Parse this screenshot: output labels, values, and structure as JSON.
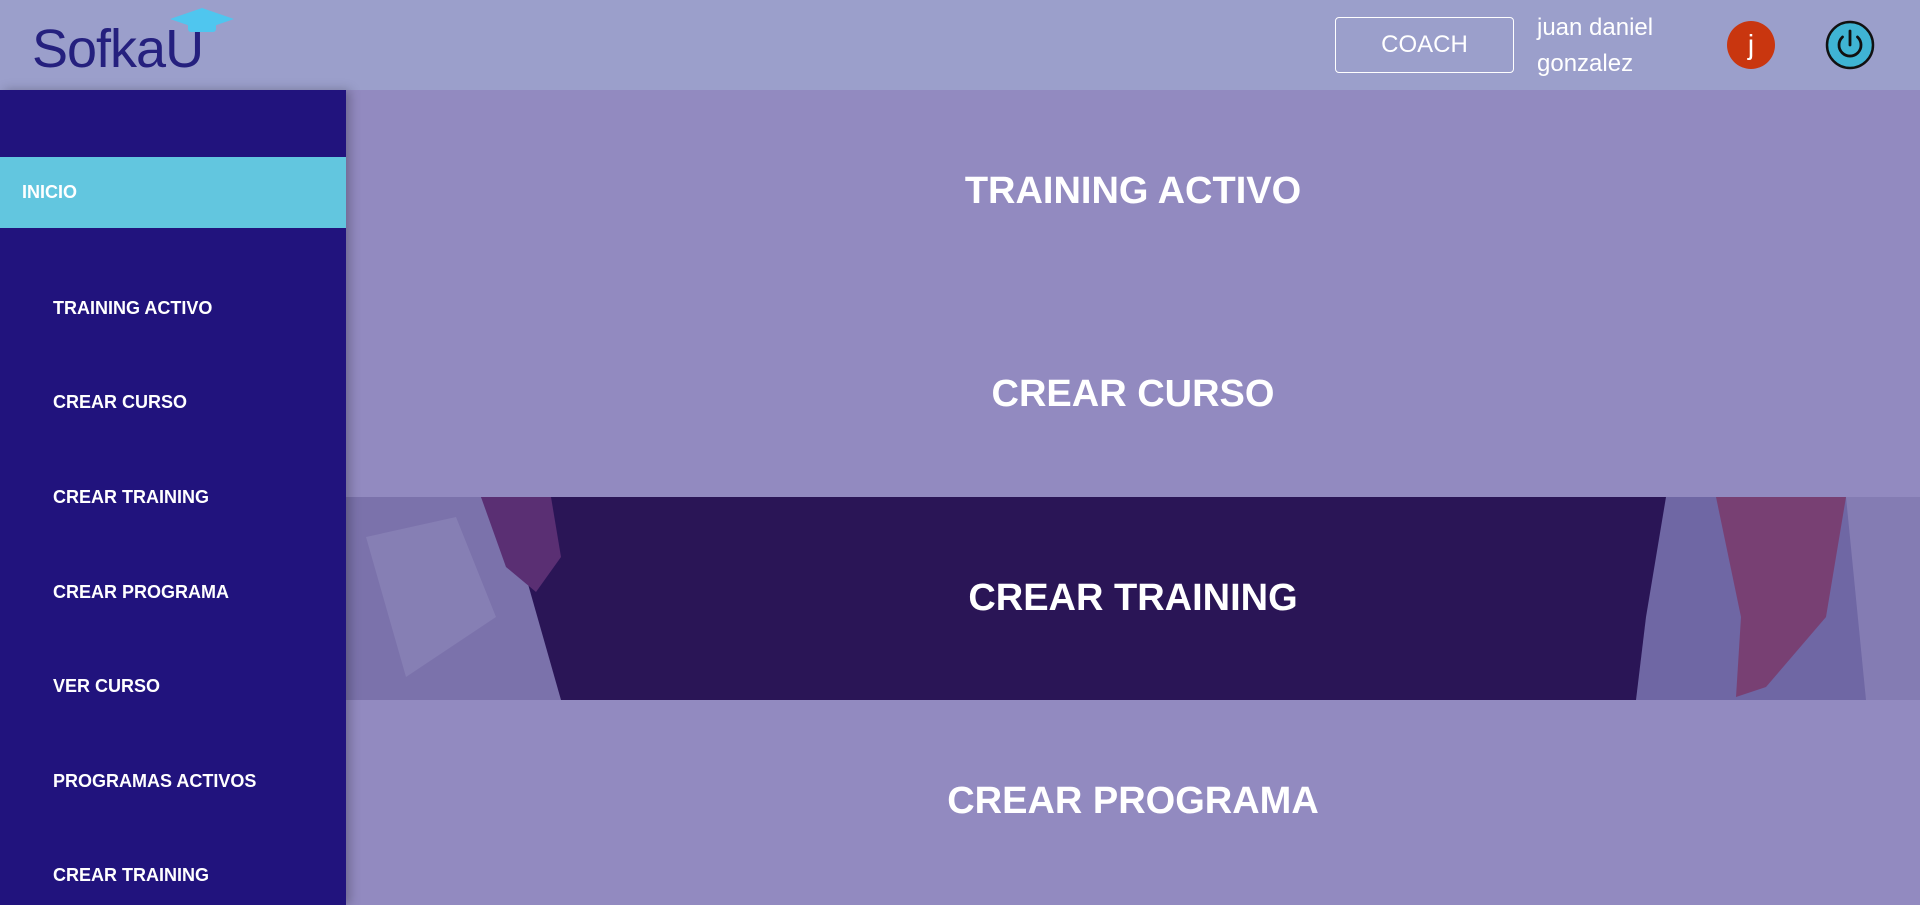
{
  "header": {
    "logo_text": "SofkaU",
    "role_label": "COACH",
    "user_name": "juan daniel gonzalez",
    "avatar_initial": "j"
  },
  "sidebar": {
    "home_label": "INICIO",
    "items": [
      {
        "label": "TRAINING ACTIVO"
      },
      {
        "label": "CREAR CURSO"
      },
      {
        "label": "CREAR TRAINING"
      },
      {
        "label": "CREAR PROGRAMA"
      },
      {
        "label": "VER CURSO"
      },
      {
        "label": "PROGRAMAS ACTIVOS"
      },
      {
        "label": "CREAR TRAINING"
      }
    ]
  },
  "main": {
    "cards": [
      {
        "label": "TRAINING ACTIVO"
      },
      {
        "label": "CREAR CURSO"
      },
      {
        "label": "CREAR TRAINING"
      },
      {
        "label": "CREAR PROGRAMA"
      }
    ]
  },
  "colors": {
    "topbar": "#9b9fcb",
    "sidebar": "#21137d",
    "sidebar_active": "#62c6df",
    "main": "#928ac0",
    "logo": "#25207e",
    "avatar": "#c9360f",
    "power_icon": "#3fb4d4"
  }
}
